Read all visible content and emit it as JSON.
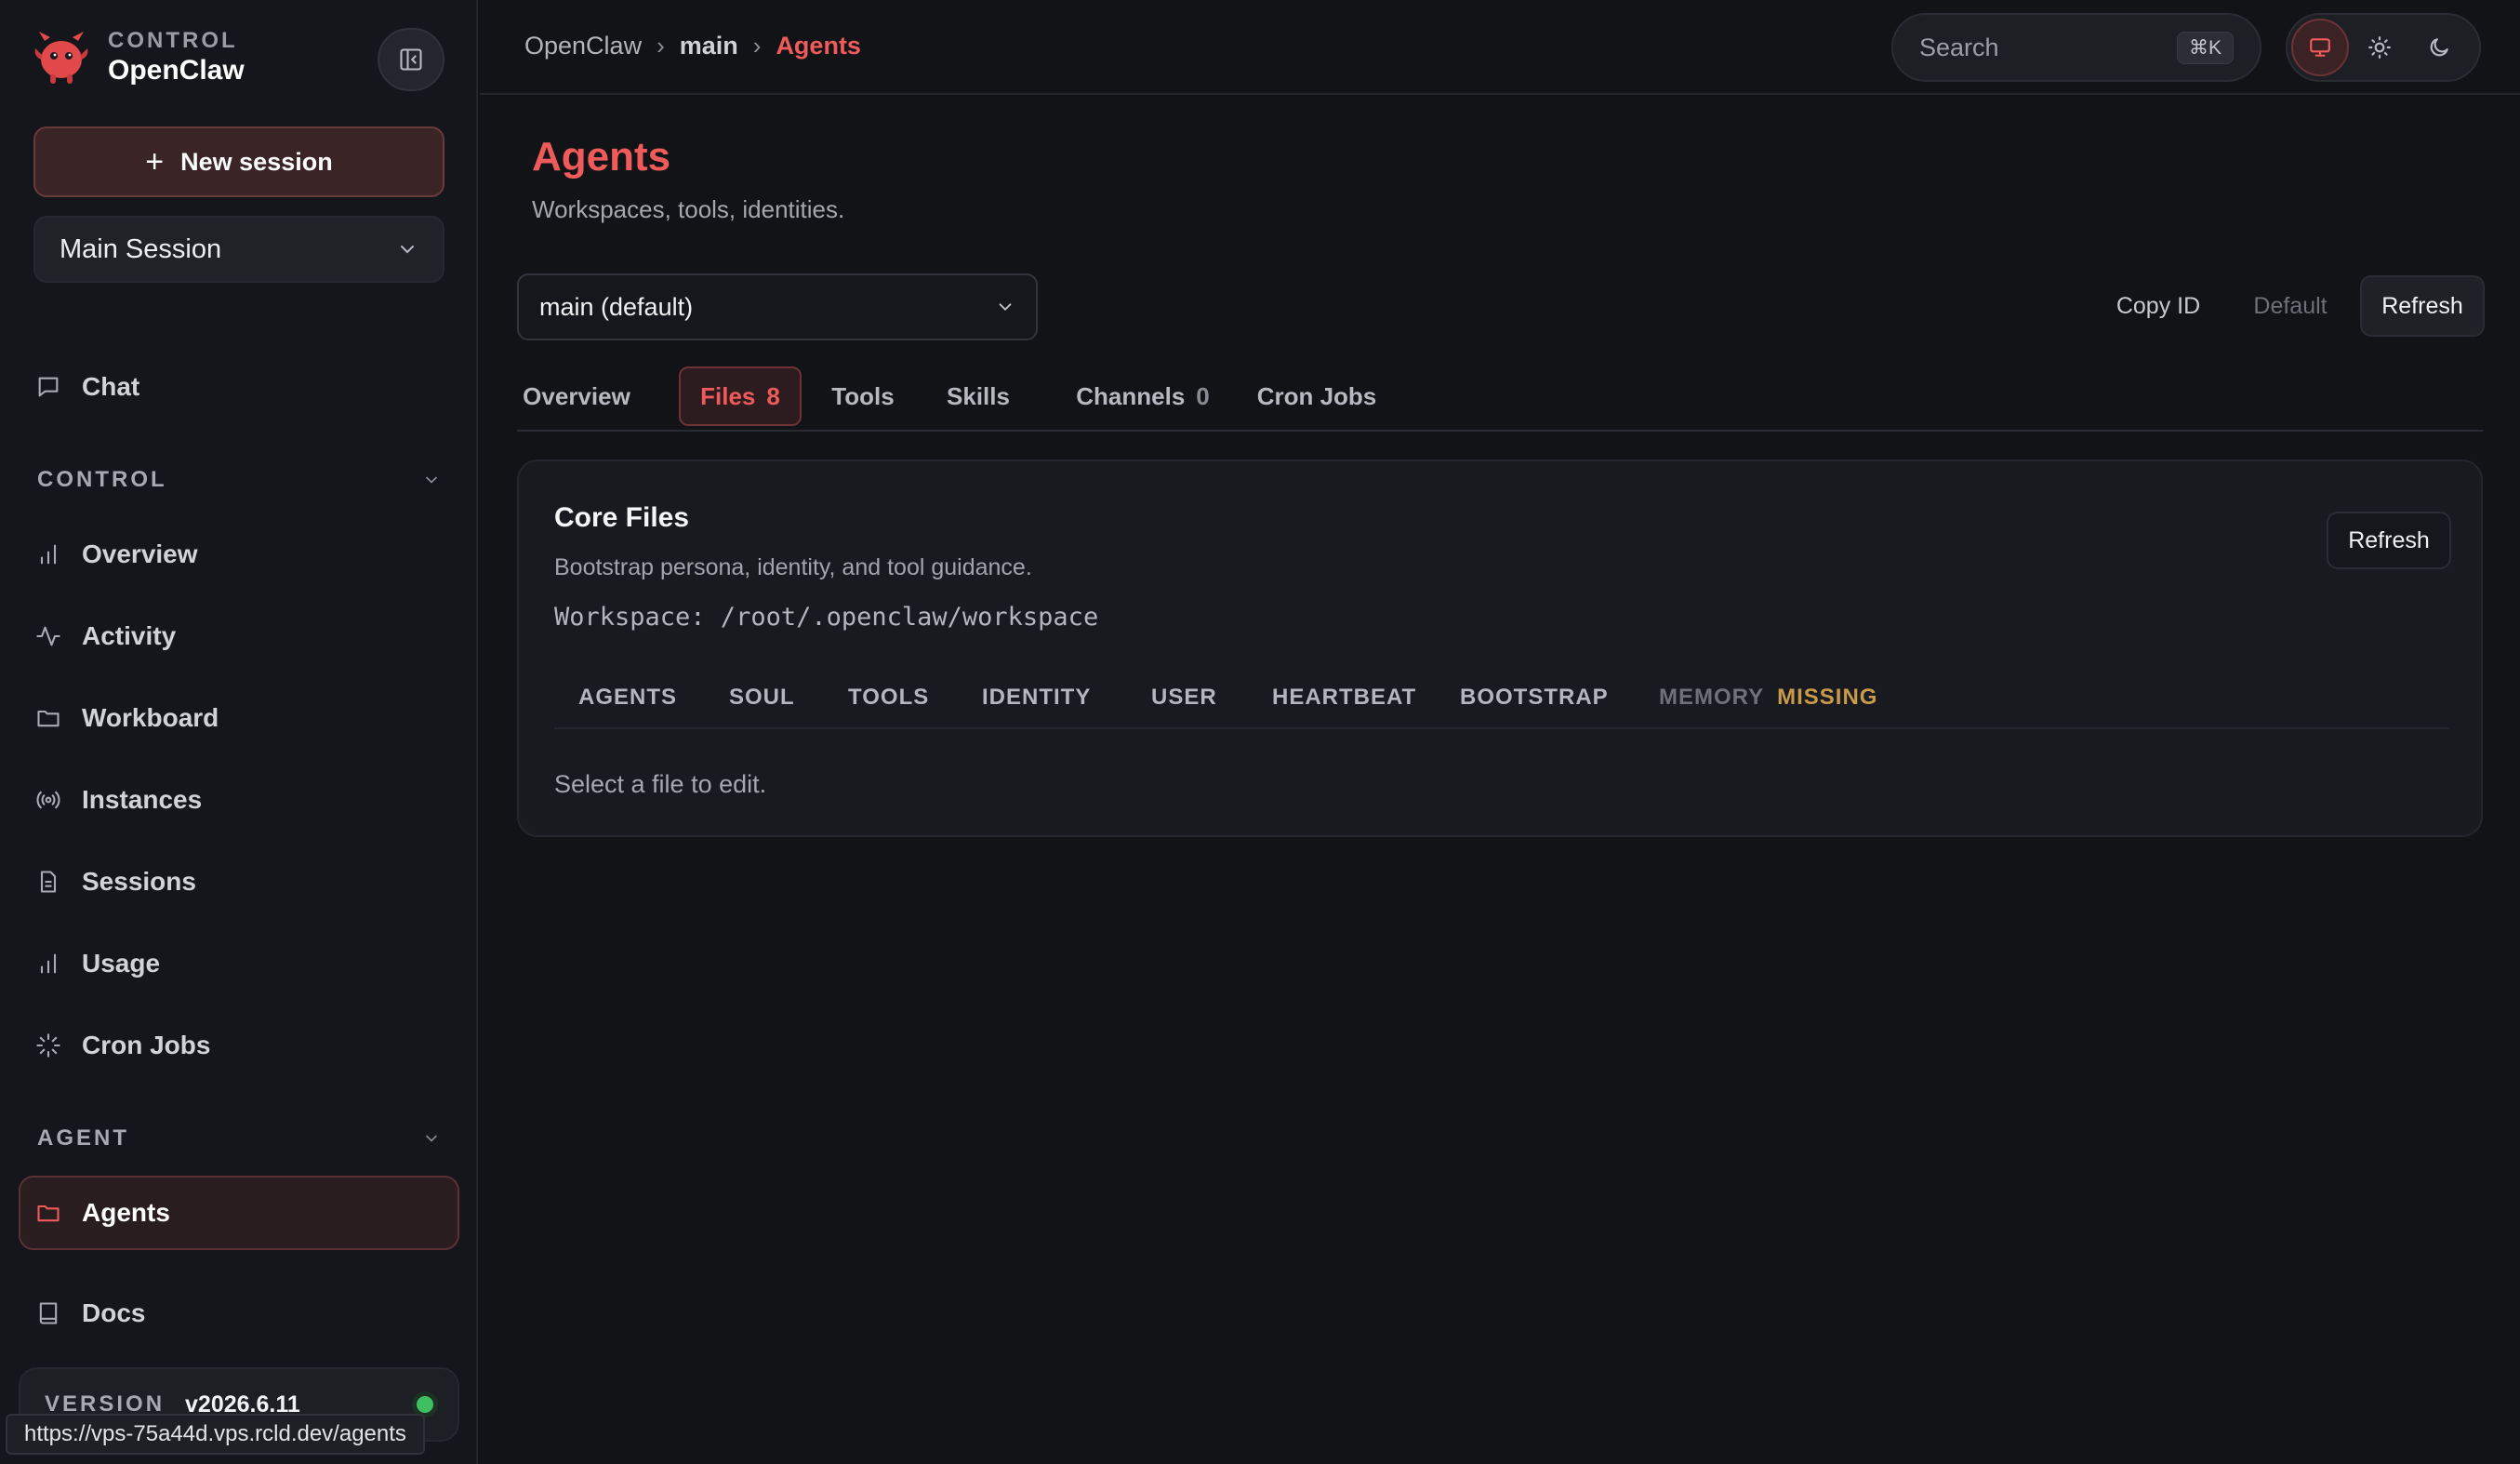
{
  "sidebar": {
    "brand_eyebrow": "CONTROL",
    "brand_name": "OpenClaw",
    "new_session_label": "New session",
    "session_selected": "Main Session",
    "chat_label": "Chat",
    "section_control": "CONTROL",
    "control_items": [
      "Overview",
      "Activity",
      "Workboard",
      "Instances",
      "Sessions",
      "Usage",
      "Cron Jobs"
    ],
    "section_agent": "AGENT",
    "agents_label": "Agents",
    "docs_label": "Docs",
    "version_label": "VERSION",
    "version_value": "v2026.6.11"
  },
  "topbar": {
    "breadcrumb": [
      "OpenClaw",
      "main",
      "Agents"
    ],
    "search_placeholder": "Search",
    "search_shortcut": "⌘K"
  },
  "page": {
    "title": "Agents",
    "subtitle": "Workspaces, tools, identities.",
    "agent_selected": "main (default)",
    "actions": {
      "copy_id": "Copy ID",
      "default": "Default",
      "refresh": "Refresh"
    },
    "tabs": [
      {
        "label": "Overview",
        "count": ""
      },
      {
        "label": "Files",
        "count": "8"
      },
      {
        "label": "Tools",
        "count": ""
      },
      {
        "label": "Skills",
        "count": ""
      },
      {
        "label": "Channels",
        "count": "0"
      },
      {
        "label": "Cron Jobs",
        "count": ""
      }
    ],
    "active_tab": "Files"
  },
  "core_files": {
    "title": "Core Files",
    "description": "Bootstrap persona, identity, and tool guidance.",
    "workspace": "Workspace: /root/.openclaw/workspace",
    "refresh_label": "Refresh",
    "files": [
      "AGENTS",
      "SOUL",
      "TOOLS",
      "IDENTITY",
      "USER",
      "HEARTBEAT",
      "BOOTSTRAP",
      "MEMORY"
    ],
    "missing_tag": "MISSING",
    "empty_state": "Select a file to edit."
  },
  "status_url": "https://vps-75a44d.vps.rcld.dev/agents",
  "colors": {
    "accent": "#ef5b5b",
    "background": "#121317",
    "sidebar": "#15161b",
    "status_online": "#3fbf62",
    "missing": "#c89a4a"
  },
  "icons": [
    "openclaw-logo-icon",
    "sidebar-collapse-icon",
    "plus-icon",
    "chevron-down-icon",
    "chat-icon",
    "bar-chart-icon",
    "activity-icon",
    "folder-icon",
    "radio-icon",
    "file-icon",
    "loader-icon",
    "book-icon",
    "monitor-icon",
    "sun-icon",
    "moon-icon"
  ]
}
